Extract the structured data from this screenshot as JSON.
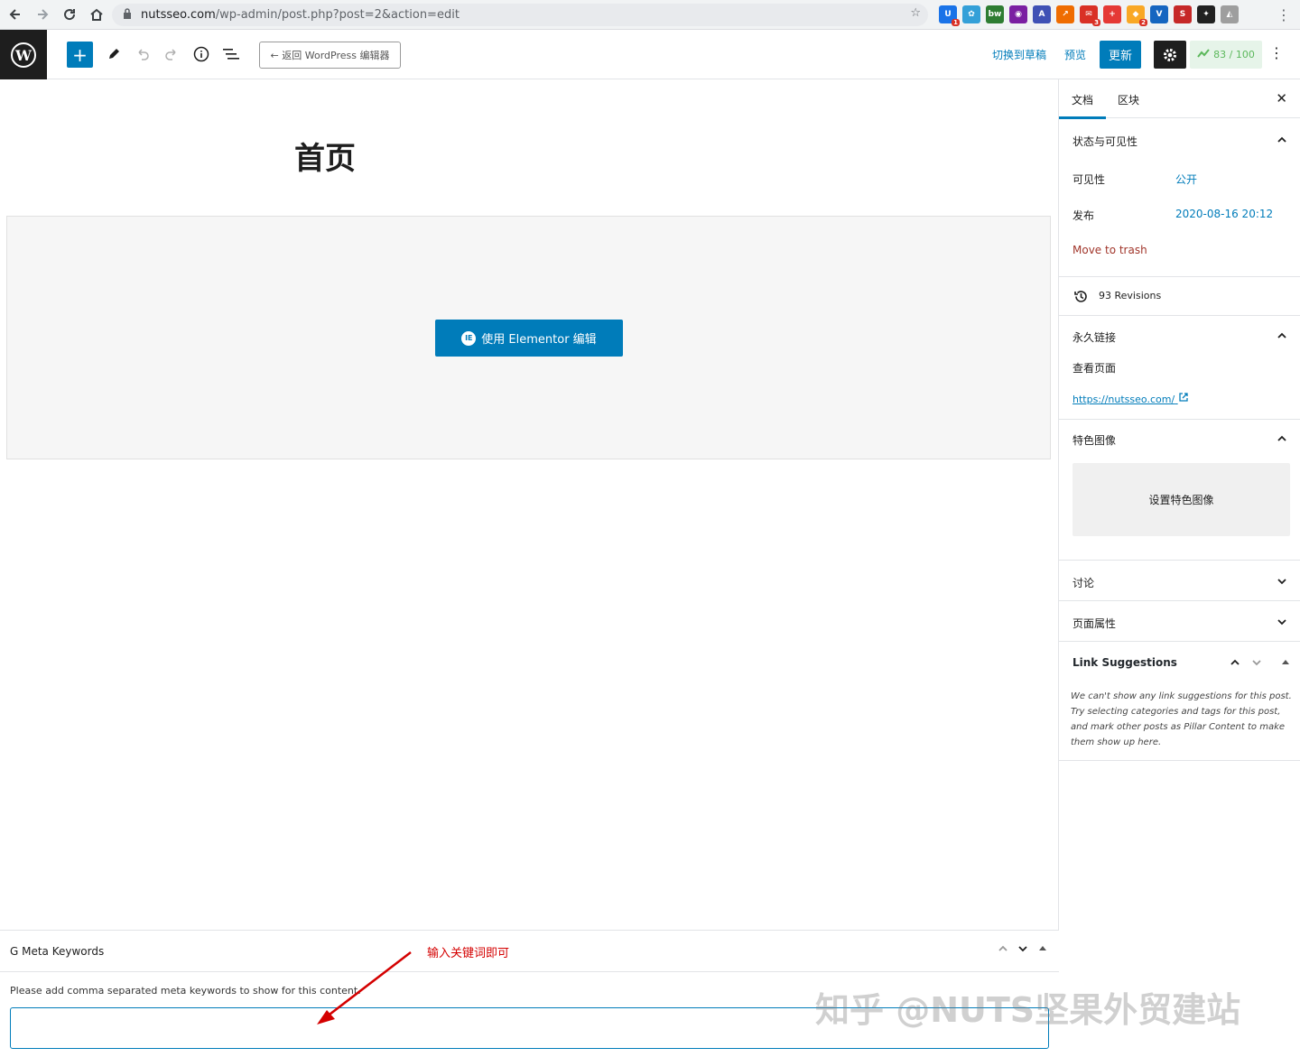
{
  "browser": {
    "url_host": "nutsseo.com",
    "url_path": "/wp-admin/post.php?post=2&action=edit",
    "extensions": [
      {
        "name": "ext-1",
        "label": "U",
        "badge": "1",
        "color": "#1a73e8"
      },
      {
        "name": "ext-2",
        "label": "✿",
        "badge": "",
        "color": "#34a0d8"
      },
      {
        "name": "ext-3",
        "label": "bw",
        "badge": "",
        "color": "#2e7d32"
      },
      {
        "name": "ext-4",
        "label": "◉",
        "badge": "",
        "color": "#7b1fa2"
      },
      {
        "name": "ext-5",
        "label": "A",
        "badge": "",
        "color": "#3f51b5"
      },
      {
        "name": "ext-6",
        "label": "↗",
        "badge": "",
        "color": "#ef6c00"
      },
      {
        "name": "ext-7",
        "label": "✉",
        "badge": "3",
        "color": "#d93025"
      },
      {
        "name": "ext-8",
        "label": "+",
        "badge": "",
        "color": "#e53935"
      },
      {
        "name": "ext-9",
        "label": "◆",
        "badge": "2",
        "color": "#f9a825"
      },
      {
        "name": "ext-10",
        "label": "V",
        "badge": "",
        "color": "#1565c0"
      },
      {
        "name": "ext-11",
        "label": "S",
        "badge": "",
        "color": "#c62828"
      },
      {
        "name": "ext-12",
        "label": "✦",
        "badge": "",
        "color": "#212121"
      },
      {
        "name": "ext-13",
        "label": "◭",
        "badge": "",
        "color": "#9e9e9e"
      }
    ]
  },
  "header": {
    "back_label": "← 返回 WordPress 编辑器",
    "switch_draft": "切换到草稿",
    "preview": "预览",
    "update": "更新",
    "seo_score": "83 / 100"
  },
  "editor": {
    "title": "首页",
    "elementor_button": "使用 Elementor 编辑"
  },
  "sidebar": {
    "tabs": [
      "文档",
      "区块"
    ],
    "status": {
      "title": "状态与可见性",
      "visibility_label": "可见性",
      "visibility_value": "公开",
      "publish_label": "发布",
      "publish_value": "2020-08-16 20:12",
      "trash": "Move to trash"
    },
    "revisions": "93 Revisions",
    "permalink": {
      "title": "永久链接",
      "view_page": "查看页面",
      "url": "https://nutsseo.com/"
    },
    "featured": {
      "title": "特色图像",
      "set_button": "设置特色图像"
    },
    "discussion": "讨论",
    "page_attributes": "页面属性",
    "link_suggestions": {
      "title": "Link Suggestions",
      "description": "We can't show any link suggestions for this post. Try selecting categories and tags for this post, and mark other posts as Pillar Content to make them show up here."
    }
  },
  "meta_box": {
    "title": "G Meta Keywords",
    "description": "Please add comma separated meta keywords to show for this content.",
    "input_value": ""
  },
  "annotation": "输入关键词即可",
  "watermark": "知乎 @NUTS坚果外贸建站",
  "colors": {
    "accent": "#007cba",
    "dark": "#1e1e1e",
    "trash": "#a1362b",
    "annotation": "#d40000"
  }
}
